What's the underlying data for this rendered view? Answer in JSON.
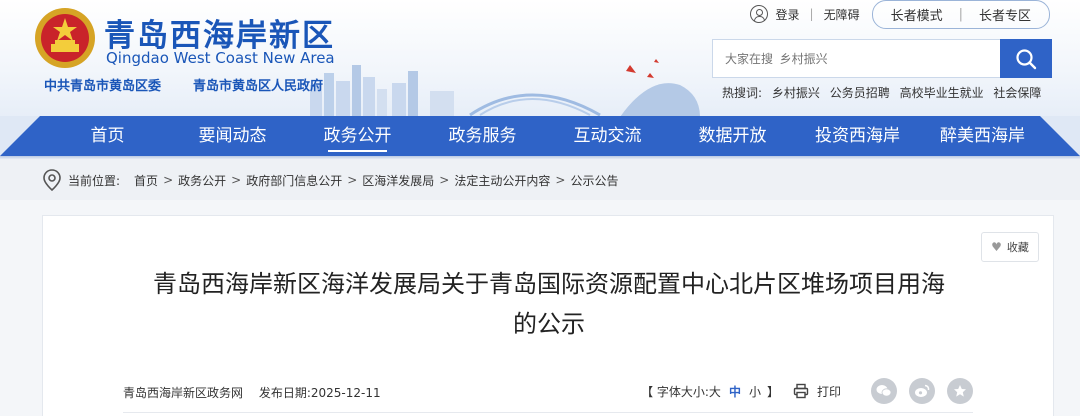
{
  "site": {
    "title_cn": "青岛西海岸新区",
    "title_en": "Qingdao West Coast New Area",
    "org1": "中共青岛市黄岛区委",
    "org2": "青岛市黄岛区人民政府"
  },
  "top_links": {
    "login": "登录",
    "accessibility": "无障碍",
    "senior_mode": "长者模式",
    "senior_zone": "长者专区"
  },
  "search": {
    "placeholder": "大家在搜  乡村振兴",
    "hot_label": "热搜词:",
    "hot_words": [
      "乡村振兴",
      "公务员招聘",
      "高校毕业生就业",
      "社会保障"
    ]
  },
  "nav": {
    "items": [
      "首页",
      "要闻动态",
      "政务公开",
      "政务服务",
      "互动交流",
      "数据开放",
      "投资西海岸",
      "醉美西海岸"
    ],
    "active_index": 2
  },
  "breadcrumb": {
    "label": "当前位置:",
    "items": [
      "首页",
      "政务公开",
      "政府部门信息公开",
      "区海洋发展局",
      "法定主动公开内容",
      "公示公告"
    ],
    "separator": ">"
  },
  "article": {
    "favorite_label": "收藏",
    "title_line1": "青岛西海岸新区海洋发展局关于青岛国际资源配置中心北片区堆场项目用海",
    "title_line2": "的公示",
    "source": "青岛西海岸新区政务网",
    "publish_label": "发布日期:2025-12-11",
    "font_size_label": "【 字体大小:",
    "font_large": "大",
    "font_medium": "中",
    "font_small": "小",
    "font_close": "】",
    "print_label": "打印",
    "share_icons": [
      "wechat-icon",
      "weibo-icon",
      "star-icon"
    ]
  },
  "colors": {
    "brand_blue": "#2f63c7",
    "title_blue": "#1a56b8"
  }
}
